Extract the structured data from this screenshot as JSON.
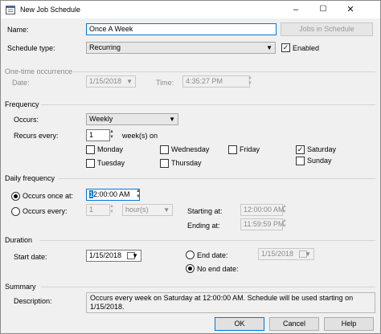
{
  "window": {
    "title": "New Job Schedule"
  },
  "controls": {
    "minimize": "–",
    "maximize": "☐",
    "close": "✕"
  },
  "name": {
    "label": "Name:",
    "value": "Once A Week",
    "jobs_button": "Jobs in Schedule"
  },
  "schedule_type": {
    "label": "Schedule type:",
    "value": "Recurring",
    "enabled_label": "Enabled",
    "enabled_checked": "✓"
  },
  "one_time": {
    "heading": "One-time occurrence",
    "date_label": "Date:",
    "date_value": "1/15/2018",
    "time_label": "Time:",
    "time_value": "4:35:27 PM"
  },
  "frequency": {
    "heading": "Frequency",
    "occurs_label": "Occurs:",
    "occurs_value": "Weekly",
    "recurs_label": "Recurs every:",
    "recurs_value": "1",
    "recurs_unit": "week(s) on",
    "days": {
      "monday": "Monday",
      "wednesday": "Wednesday",
      "friday": "Friday",
      "saturday": "Saturday",
      "tuesday": "Tuesday",
      "thursday": "Thursday",
      "sunday": "Sunday",
      "saturday_check": "✓"
    }
  },
  "daily": {
    "heading": "Daily frequency",
    "once_label": "Occurs once at:",
    "once_value_hour": "1",
    "once_value_rest": "2:00:00 AM",
    "every_label": "Occurs every:",
    "every_value": "1",
    "every_unit": "hour(s)",
    "starting_label": "Starting at:",
    "starting_value": "12:00:00 AM",
    "ending_label": "Ending at:",
    "ending_value": "11:59:59 PM"
  },
  "duration": {
    "heading": "Duration",
    "start_label": "Start date:",
    "start_value": "1/15/2018",
    "end_label": "End date:",
    "end_value": "1/15/2018",
    "no_end_label": "No end date:"
  },
  "summary": {
    "heading": "Summary",
    "desc_label": "Description:",
    "desc_value": "Occurs every week on Saturday at 12:00:00 AM. Schedule will be used starting on 1/15/2018."
  },
  "buttons": {
    "ok": "OK",
    "cancel": "Cancel",
    "help": "Help"
  },
  "icons": {
    "spin_up": "▲",
    "spin_down": "▼",
    "dropdown": "▼"
  }
}
